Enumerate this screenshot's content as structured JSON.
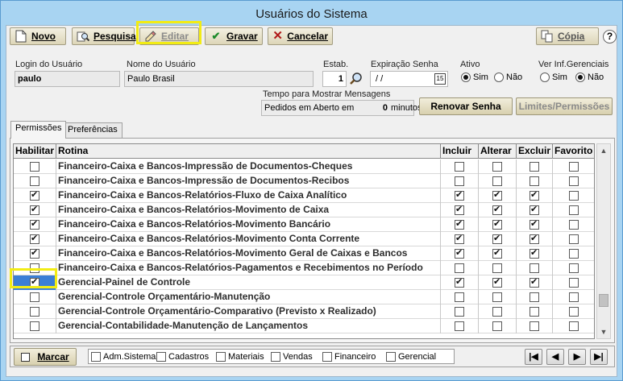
{
  "window": {
    "title": "Usuários do Sistema"
  },
  "toolbar": {
    "novo": "Novo",
    "pesquisa": "Pesquisa",
    "editar": "Editar",
    "gravar": "Gravar",
    "cancelar": "Cancelar",
    "copia": "Cópia"
  },
  "form": {
    "login_label": "Login do Usuário",
    "login_value": "paulo",
    "nome_label": "Nome do Usuário",
    "nome_value": "Paulo Brasil",
    "estab_label": "Estab.",
    "estab_value": "1",
    "exp_label": "Expiração Senha",
    "exp_value": " / /",
    "cal_day": "15",
    "ativo_label": "Ativo",
    "ativo_sim": "Sim",
    "ativo_nao": "Não",
    "ativo_selected": "Sim",
    "verinf_label": "Ver Inf.Gerenciais",
    "verinf_sim": "Sim",
    "verinf_nao": "Não",
    "verinf_selected": "Não",
    "tempo_label": "Tempo para Mostrar Mensagens",
    "pedidos_label": "Pedidos em Aberto em",
    "pedidos_value": "0",
    "pedidos_unit": "minutos.",
    "renovar": "Renovar Senha",
    "limites": "Limites/Permissões"
  },
  "tabs": [
    {
      "label": "Permissões",
      "active": true
    },
    {
      "label": "Preferências",
      "active": false
    }
  ],
  "grid": {
    "headers": [
      "Habilitar",
      "Rotina",
      "Incluir",
      "Alterar",
      "Excluir",
      "Favorito"
    ],
    "rows": [
      {
        "rotina": "Financeiro-Caixa e Bancos-Impressão de Documentos-Cheques",
        "habilitar": false,
        "incluir": false,
        "alterar": false,
        "excluir": false,
        "favorito": false
      },
      {
        "rotina": "Financeiro-Caixa e Bancos-Impressão de Documentos-Recibos",
        "habilitar": false,
        "incluir": false,
        "alterar": false,
        "excluir": false,
        "favorito": false
      },
      {
        "rotina": "Financeiro-Caixa e Bancos-Relatórios-Fluxo de Caixa Analítico",
        "habilitar": true,
        "incluir": true,
        "alterar": true,
        "excluir": true,
        "favorito": false
      },
      {
        "rotina": "Financeiro-Caixa e Bancos-Relatórios-Movimento de Caixa",
        "habilitar": true,
        "incluir": true,
        "alterar": true,
        "excluir": true,
        "favorito": false
      },
      {
        "rotina": "Financeiro-Caixa e Bancos-Relatórios-Movimento Bancário",
        "habilitar": true,
        "incluir": true,
        "alterar": true,
        "excluir": true,
        "favorito": false
      },
      {
        "rotina": "Financeiro-Caixa e Bancos-Relatórios-Movimento Conta Corrente",
        "habilitar": true,
        "incluir": true,
        "alterar": true,
        "excluir": true,
        "favorito": false
      },
      {
        "rotina": "Financeiro-Caixa e Bancos-Relatórios-Movimento Geral de Caixas e Bancos",
        "habilitar": true,
        "incluir": true,
        "alterar": true,
        "excluir": true,
        "favorito": false
      },
      {
        "rotina": "Financeiro-Caixa e Bancos-Relatórios-Pagamentos e Recebimentos no Período",
        "habilitar": false,
        "incluir": false,
        "alterar": false,
        "excluir": false,
        "favorito": false
      },
      {
        "rotina": "Gerencial-Painel de Controle",
        "habilitar": true,
        "incluir": true,
        "alterar": true,
        "excluir": true,
        "favorito": false,
        "selected": true
      },
      {
        "rotina": "Gerencial-Controle Orçamentário-Manutenção",
        "habilitar": false,
        "incluir": false,
        "alterar": false,
        "excluir": false,
        "favorito": false
      },
      {
        "rotina": "Gerencial-Controle Orçamentário-Comparativo (Previsto x Realizado)",
        "habilitar": false,
        "incluir": false,
        "alterar": false,
        "excluir": false,
        "favorito": false
      },
      {
        "rotina": "Gerencial-Contabilidade-Manutenção de Lançamentos",
        "habilitar": false,
        "incluir": false,
        "alterar": false,
        "excluir": false,
        "favorito": false
      }
    ]
  },
  "bottom": {
    "marcar": "Marcar",
    "filters": [
      "Adm.Sistema",
      "Cadastros",
      "Materiais",
      "Vendas",
      "Financeiro",
      "Gerencial"
    ]
  },
  "icons": {
    "novo": "new-document-icon",
    "pesquisa": "search-icon",
    "editar": "edit-pencil-icon",
    "gravar": "check-icon",
    "cancelar": "cancel-x-icon",
    "copia": "copy-icon",
    "help": "help-icon",
    "search": "magnifier-icon",
    "calendar": "calendar-icon"
  },
  "colors": {
    "highlight": "#f2ec14",
    "selection": "#3b7fd6",
    "gravar": "#1d8a2a",
    "cancelar": "#b01919"
  }
}
